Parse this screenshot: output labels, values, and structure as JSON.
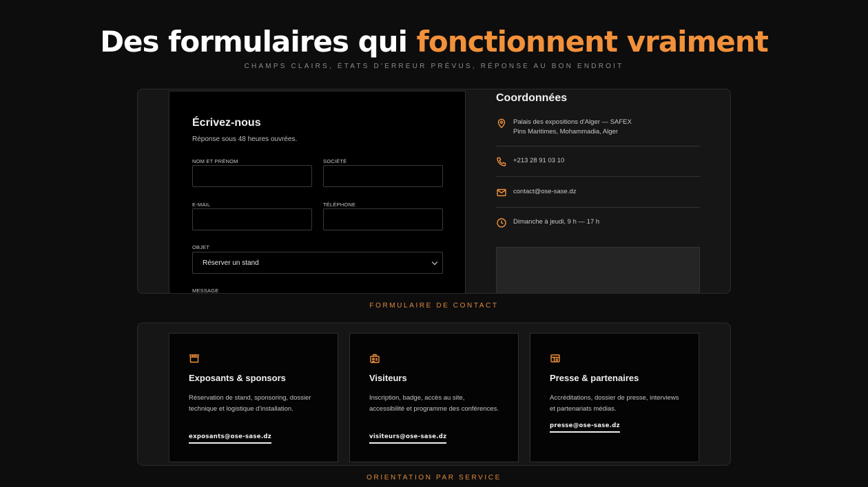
{
  "hero": {
    "title_main": "Des formulaires qui ",
    "title_accent": "fonctionnent vraiment",
    "subtitle": "CHAMPS CLAIRS, ÉTATS D'ERREUR PRÉVUS, RÉPONSE AU BON ENDROIT"
  },
  "colors": {
    "accent": "#f2913b",
    "background": "#0d0d0d",
    "panel": "#000000"
  },
  "contact_form": {
    "title": "Écrivez-nous",
    "subtitle": "Réponse sous 48 heures ouvrées.",
    "fields": {
      "name_label": "NOM ET PRÉNOM",
      "company_label": "SOCIÉTÉ",
      "email_label": "E-MAIL",
      "phone_label": "TÉLÉPHONE",
      "subject_label": "OBJET",
      "subject_value": "Réserver un stand",
      "message_label": "MESSAGE"
    }
  },
  "coordinates": {
    "title": "Coordonnées",
    "address_line1": "Palais des expositions d'Alger — SAFEX",
    "address_line2": "Pins Maritimes, Mohammadia, Alger",
    "phone": "+213 28 91 03 10",
    "email": "contact@ose-sase.dz",
    "hours": "Dimanche à jeudi, 9 h — 17 h",
    "icons": [
      "map-pin-icon",
      "phone-icon",
      "mail-icon",
      "clock-icon"
    ]
  },
  "captions": {
    "contact": "FORMULAIRE DE CONTACT",
    "services": "ORIENTATION PAR SERVICE"
  },
  "services": [
    {
      "icon": "store-icon",
      "title": "Exposants & sponsors",
      "description": "Réservation de stand, sponsoring, dossier technique et logistique d'installation.",
      "email": "exposants@ose-sase.dz"
    },
    {
      "icon": "badge-icon",
      "title": "Visiteurs",
      "description": "Inscription, badge, accès au site, accessibilité et programme des conférences.",
      "email": "visiteurs@ose-sase.dz"
    },
    {
      "icon": "newspaper-icon",
      "title": "Presse & partenaires",
      "description": "Accréditations, dossier de presse, interviews et partenariats médias.",
      "email": "presse@ose-sase.dz"
    }
  ]
}
